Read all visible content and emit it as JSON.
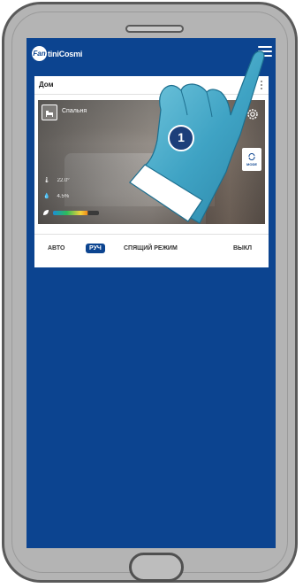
{
  "app": {
    "logo_mark": "Fan",
    "logo_text": "tiniCosmi"
  },
  "header": {
    "menu_icon": "hamburger-menu-icon"
  },
  "card": {
    "title": "Дом",
    "room_name": "Спальня",
    "mode_button_label": "MODE",
    "temperature": "22.0°",
    "humidity": "4.5%",
    "modes": [
      {
        "label": "АВТО",
        "active": false
      },
      {
        "label": "РУЧ",
        "active": true
      },
      {
        "label": "СПЯЩИЙ РЕЖИМ",
        "active": false
      },
      {
        "label": "ВЫКЛ",
        "active": false
      }
    ]
  },
  "callout": {
    "step_number": "1"
  },
  "colors": {
    "screen_bg": "#0c4490",
    "accent": "#0c4490",
    "hand": "#3fa3c4"
  }
}
